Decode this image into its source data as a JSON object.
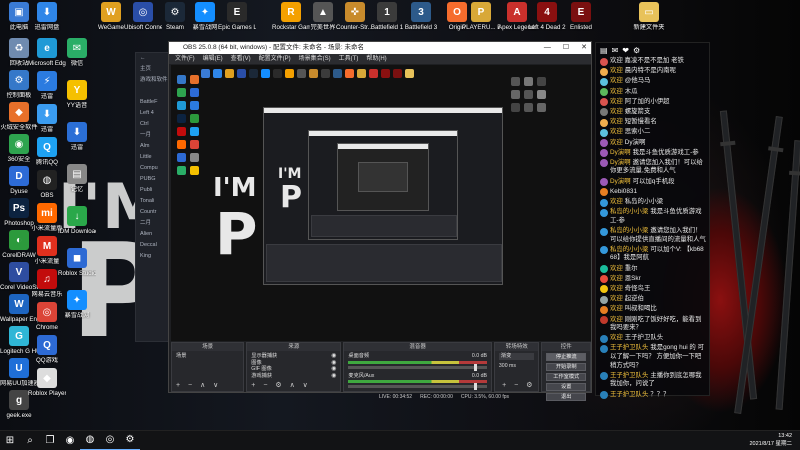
{
  "desktop": {
    "background_text": {
      "line1": "I'M",
      "line2": "P"
    },
    "icons_top": [
      {
        "label": "此电脑",
        "color": "#3a7bd5",
        "glyph": "▣"
      },
      {
        "label": "迅雷网盘",
        "color": "#2f86e8",
        "glyph": "⬇"
      },
      {
        "label": "WeGame",
        "color": "#e0a020",
        "glyph": "W"
      },
      {
        "label": "Ubisoft Connect",
        "color": "#2a4ea8",
        "glyph": "◎"
      },
      {
        "label": "Steam",
        "color": "#1b2838",
        "glyph": "⚙"
      },
      {
        "label": "暴雪战网",
        "color": "#148eff",
        "glyph": "✦"
      },
      {
        "label": "Epic Games Launcher",
        "color": "#2a2a2a",
        "glyph": "E"
      },
      {
        "label": "Rockstar Games...",
        "color": "#f4a000",
        "glyph": "R"
      },
      {
        "label": "完美世界",
        "color": "#555",
        "glyph": "▲"
      },
      {
        "label": "Counter-Str... Global Off...",
        "color": "#c88b2c",
        "glyph": "✜"
      },
      {
        "label": "Battlefield 1",
        "color": "#3b3b3b",
        "glyph": "1"
      },
      {
        "label": "Battlefield 3",
        "color": "#2d5a8a",
        "glyph": "3"
      },
      {
        "label": "Origin",
        "color": "#f56c2d",
        "glyph": "O"
      },
      {
        "label": "PLAYERU... BATTLEGR...",
        "color": "#d8a838",
        "glyph": "P"
      },
      {
        "label": "Apex Legends",
        "color": "#c9302c",
        "glyph": "A"
      },
      {
        "label": "Left 4 Dead 2",
        "color": "#8a1010",
        "glyph": "4"
      },
      {
        "label": "Enlisted",
        "color": "#7a1010",
        "glyph": "E"
      },
      {
        "label": "新建文件夹",
        "color": "#e8c25a",
        "glyph": "▭"
      }
    ],
    "icons_col1": [
      {
        "label": "回收站",
        "color": "#6f8bb0",
        "glyph": "♻"
      },
      {
        "label": "控制面板",
        "color": "#3578c9",
        "glyph": "⚙"
      },
      {
        "label": "火绒安全软件",
        "color": "#e8702a",
        "glyph": "◆"
      },
      {
        "label": "360安全",
        "color": "#2ea44f",
        "glyph": "◉"
      },
      {
        "label": "Dyuse",
        "color": "#2d6bd6",
        "glyph": "D"
      },
      {
        "label": "Photoshop",
        "color": "#0c2340",
        "glyph": "Ps"
      },
      {
        "label": "CorelDRAW",
        "color": "#2c9a3c",
        "glyph": "◐"
      },
      {
        "label": "Corel VideoStud...",
        "color": "#2e4da0",
        "glyph": "V"
      },
      {
        "label": "Wallpaper Engine",
        "color": "#1d65c1",
        "glyph": "W"
      },
      {
        "label": "Logitech G HUB",
        "color": "#2fb6d6",
        "glyph": "G"
      },
      {
        "label": "网易UU加速器",
        "color": "#1f6fd8",
        "glyph": "U"
      },
      {
        "label": "geek.exe",
        "color": "#444",
        "glyph": "g"
      }
    ],
    "icons_col2": [
      {
        "label": "Microsoft Edge",
        "color": "#1f9ad6",
        "glyph": "e"
      },
      {
        "label": "迅雷",
        "color": "#2b7be0",
        "glyph": "⚡"
      },
      {
        "label": "迅雷",
        "color": "#3a9cf0",
        "glyph": "⬇"
      },
      {
        "label": "腾讯QQ",
        "color": "#1ea2f2",
        "glyph": "Q"
      },
      {
        "label": "OBS",
        "color": "#222",
        "glyph": "◍"
      },
      {
        "label": "小米流量版",
        "color": "#ff6900",
        "glyph": "mi"
      },
      {
        "label": "小米流量",
        "color": "#e0301e",
        "glyph": "M"
      },
      {
        "label": "网易云音乐",
        "color": "#c20c0c",
        "glyph": "♫"
      },
      {
        "label": "Chrome",
        "color": "#db4437",
        "glyph": "◎"
      },
      {
        "label": "QQ游戏",
        "color": "#2d6ad4",
        "glyph": "Q"
      },
      {
        "label": "Roblox Player",
        "color": "#ddd",
        "glyph": "◆"
      }
    ],
    "icons_col3": [
      {
        "label": "微信",
        "color": "#2aae67",
        "glyph": "✉"
      },
      {
        "label": "YY语音",
        "color": "#f5c000",
        "glyph": "Y"
      },
      {
        "label": "迅雷",
        "color": "#2b6fd6",
        "glyph": "⬇"
      },
      {
        "label": "记忆",
        "color": "#888",
        "glyph": "▤"
      },
      {
        "label": "IDM Downloader",
        "color": "#2aa84a",
        "glyph": "↓"
      },
      {
        "label": "Roblox Studio",
        "color": "#2d6ad4",
        "glyph": "◼"
      },
      {
        "label": "暴雪战网",
        "color": "#148eff",
        "glyph": "✦"
      }
    ]
  },
  "browser": {
    "rows": [
      "←",
      "主页",
      "游戏和软件",
      "",
      "BattleF",
      "Left 4",
      "Ctrl",
      "一月",
      "Alm",
      "Little",
      "Compu",
      "PUBG",
      "Publi",
      "Tonali",
      "Countr",
      "二月",
      "Alien",
      "Deccal",
      "King"
    ]
  },
  "obs": {
    "title": "OBS 25.0.8 (64 bit, windows) - 配置文件: 未命名 - 场景: 未命名",
    "window_controls": [
      "—",
      "☐",
      "✕"
    ],
    "menu": [
      "文件(F)",
      "编辑(E)",
      "查看(V)",
      "配置文件(P)",
      "场景集合(S)",
      "工具(T)",
      "帮助(H)"
    ],
    "docks": {
      "scenes": {
        "title": "场景",
        "items": [
          "场景"
        ]
      },
      "sources": {
        "title": "来源",
        "items": [
          "显示器捕获",
          "图像",
          "GIF 图像",
          "游戏捕获"
        ]
      },
      "mixer": {
        "title": "混音器",
        "channels": [
          {
            "name": "桌面音频",
            "db": "0.0 dB"
          },
          {
            "name": "麦克风/Aux",
            "db": "0.0 dB"
          }
        ]
      },
      "transitions": {
        "title": "转场特效",
        "value": "渐变",
        "duration": "300 ms"
      },
      "controls": {
        "title": "控件",
        "buttons": [
          "停止推流",
          "开始录制",
          "工作室模式",
          "设置",
          "退出"
        ],
        "hover_index": 0
      }
    },
    "status": {
      "live": "LIVE: 00:34:52",
      "rec": "REC: 00:00:00",
      "cpu": "CPU: 3.5%, 60.00 fps"
    },
    "preview_overlay": {
      "im": "I'M",
      "p": "P"
    }
  },
  "chat": {
    "header_icons": [
      "▤",
      "✉",
      "❤",
      "⚙"
    ],
    "messages": [
      {
        "name": "",
        "text": "欢迎 嘉凌不是不是加 老铁",
        "color": "#d9534f"
      },
      {
        "name": "欢迎",
        "text": "晨内特不是内南呢",
        "color": "#f0ad4e"
      },
      {
        "name": "欢迎",
        "text": "@他马马",
        "color": "#5bc0de"
      },
      {
        "name": "欢迎",
        "text": "木瓜",
        "color": "#5cb85c"
      },
      {
        "name": "欢迎",
        "text": "阿了加的小伊超",
        "color": "#d9534f"
      },
      {
        "name": "欢迎",
        "text": "螺旋箭支",
        "color": "#777"
      },
      {
        "name": "欢迎",
        "text": "短暂慢看名",
        "color": "#f0ad4e"
      },
      {
        "name": "欢迎",
        "text": "思索小二",
        "color": "#5bc0de"
      },
      {
        "name": "欢迎",
        "text": "Dy演啊",
        "color": "#9b59b6"
      },
      {
        "name": "Dy演啊",
        "text": "我是斗鱼优质游戏工-参",
        "color": "#9b59b6"
      },
      {
        "name": "Dy演啊",
        "text": "邀请您加入我们！可以给你更多流量,免费和人气",
        "color": "#9b59b6"
      },
      {
        "name": "Dy演啊",
        "text": "可以加q手机段",
        "color": "#9b59b6"
      },
      {
        "name": "",
        "text": "Kebi0831",
        "color": "#e67e22"
      },
      {
        "name": "欢迎",
        "text": "私岛的小小梁",
        "color": "#3498db"
      },
      {
        "name": "私岛的小小梁",
        "text": "我是斗鱼优质游戏工-参",
        "color": "#3498db"
      },
      {
        "name": "私岛的小小梁",
        "text": "邀请您加入我们！可以给你提供直播间的流量和人气",
        "color": "#3498db"
      },
      {
        "name": "私岛的小小梁",
        "text": "可以加个V: 【kb6868】我是阿航",
        "color": "#3498db"
      },
      {
        "name": "欢迎",
        "text": "重尔",
        "color": "#1abc9c"
      },
      {
        "name": "欢迎",
        "text": "恩Skr",
        "color": "#e74c3c"
      },
      {
        "name": "欢迎",
        "text": "奇怪鸟王",
        "color": "#f1c40f"
      },
      {
        "name": "欢迎",
        "text": "起逆伯",
        "color": "#95a5a6"
      },
      {
        "name": "欢迎",
        "text": "叫叔和喝比",
        "color": "#e67e22"
      },
      {
        "name": "欢迎",
        "text": "刚刚吃了饭好好吃，能看到我吗要来？",
        "color": "#c0392b"
      },
      {
        "name": "欢迎",
        "text": "王子护卫队头",
        "color": "#2980b9"
      },
      {
        "name": "王子护卫队头",
        "text": "我是gong hui 的 可以了解一下吗？ 方便加你一下吧稍方式吗？",
        "color": "#2980b9"
      },
      {
        "name": "王子护卫队头",
        "text": "主播你到底怎哪我我加你，问说了",
        "color": "#2980b9"
      },
      {
        "name": "王子护卫队头",
        "text": "？？？",
        "color": "#2980b9"
      }
    ]
  },
  "taskbar": {
    "items": [
      {
        "name": "start-button",
        "glyph": "⊞"
      },
      {
        "name": "search-button",
        "glyph": "⌕"
      },
      {
        "name": "task-view-button",
        "glyph": "❐"
      },
      {
        "name": "app-netease",
        "glyph": "◉"
      },
      {
        "name": "app-obs",
        "glyph": "◍"
      },
      {
        "name": "app-chrome",
        "glyph": "◎"
      },
      {
        "name": "app-steam",
        "glyph": "⚙"
      }
    ],
    "time": "13:42",
    "date": "2021/8/17 星期二"
  }
}
